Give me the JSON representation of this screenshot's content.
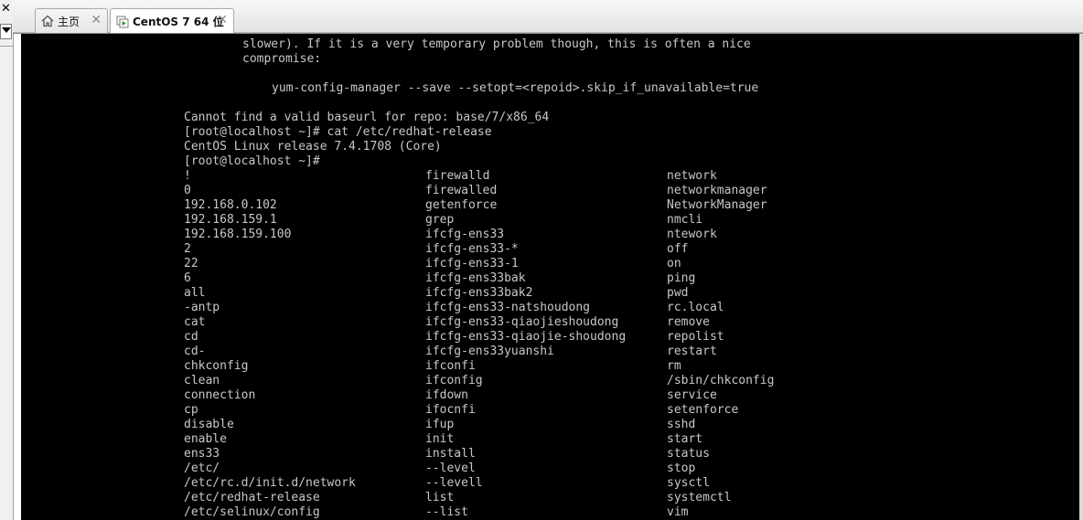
{
  "left_panel": {
    "close_glyph": "✕"
  },
  "tabs": [
    {
      "label": "主页",
      "icon": "home-icon",
      "close": "✕",
      "active": false
    },
    {
      "label": "CentOS 7 64 位",
      "icon": "vm-icon",
      "close": "✕",
      "active": true
    }
  ],
  "terminal": {
    "lines": [
      "slower). If it is a very temporary problem though, this is often a nice",
      "compromise:",
      "yum-config-manager --save --setopt=<repoid>.skip_if_unavailable=true",
      "Cannot find a valid baseurl for repo: base/7/x86_64",
      "[root@localhost ~]# cat /etc/redhat-release",
      "CentOS Linux release 7.4.1708 (Core)",
      "[root@localhost ~]#"
    ],
    "completion_columns": [
      [
        "!",
        "0",
        "192.168.0.102",
        "192.168.159.1",
        "192.168.159.100",
        "2",
        "22",
        "6",
        "all",
        "-antp",
        "cat",
        "cd",
        "cd-",
        "chkconfig",
        "clean",
        "connection",
        "cp",
        "disable",
        "enable",
        "ens33",
        "/etc/",
        "/etc/rc.d/init.d/network",
        "/etc/redhat-release",
        "/etc/selinux/config"
      ],
      [
        "firewalld",
        "firewalled",
        "getenforce",
        "grep",
        "ifcfg-ens33",
        "ifcfg-ens33-*",
        "ifcfg-ens33-1",
        "ifcfg-ens33bak",
        "ifcfg-ens33bak2",
        "ifcfg-ens33-natshoudong",
        "ifcfg-ens33-qiaojieshoudong",
        "ifcfg-ens33-qiaojie-shoudong",
        "ifcfg-ens33yuanshi",
        "ifconfi",
        "ifconfig",
        "ifdown",
        "ifocnfi",
        "ifup",
        "init",
        "install",
        "--level",
        "--levell",
        "list",
        "--list"
      ],
      [
        "network",
        "networkmanager",
        "NetworkManager",
        "nmcli",
        "ntework",
        "off",
        "on",
        "ping",
        "pwd",
        "rc.local",
        "remove",
        "repolist",
        "restart",
        "rm",
        "/sbin/chkconfig",
        "service",
        "setenforce",
        "sshd",
        "start",
        "status",
        "stop",
        "sysctl",
        "systemctl",
        "vim"
      ]
    ]
  },
  "colors": {
    "console_bg": "#000000",
    "console_text": "#c8c8c8",
    "tabbar": "#e8e8e8"
  }
}
